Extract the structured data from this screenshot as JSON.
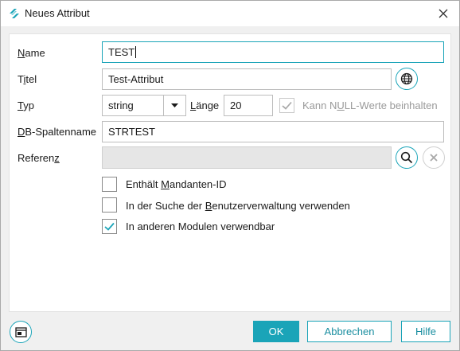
{
  "window": {
    "title": "Neues Attribut"
  },
  "form": {
    "name": {
      "label": "Name",
      "value": "TEST"
    },
    "titel": {
      "label": "Titel",
      "value": "Test-Attribut"
    },
    "typ": {
      "label": "Typ",
      "value": "string"
    },
    "laenge": {
      "label": "Länge",
      "value": "20"
    },
    "nullable": {
      "label": "Kann NULL-Werte beinhalten",
      "checked": true,
      "enabled": false
    },
    "db_spaltenname": {
      "label": "DB-Spaltenname",
      "value": "STRTEST"
    },
    "referenz": {
      "label": "Referenz",
      "value": ""
    }
  },
  "options": [
    {
      "label": "Enthält Mandanten-ID",
      "checked": false
    },
    {
      "label": "In der Suche der Benutzerverwaltung verwenden",
      "checked": false
    },
    {
      "label": "In anderen Modulen verwendbar",
      "checked": true
    }
  ],
  "footer": {
    "ok_label": "OK",
    "cancel_label": "Abbrechen",
    "help_label": "Hilfe"
  },
  "colors": {
    "accent": "#1aa4b8",
    "disabled_fill": "#e6e6e6"
  },
  "icons": [
    "app-logo-icon",
    "close-icon",
    "globe-icon",
    "search-icon",
    "clear-icon",
    "chevron-down-icon",
    "checkmark-icon",
    "layout-icon"
  ]
}
